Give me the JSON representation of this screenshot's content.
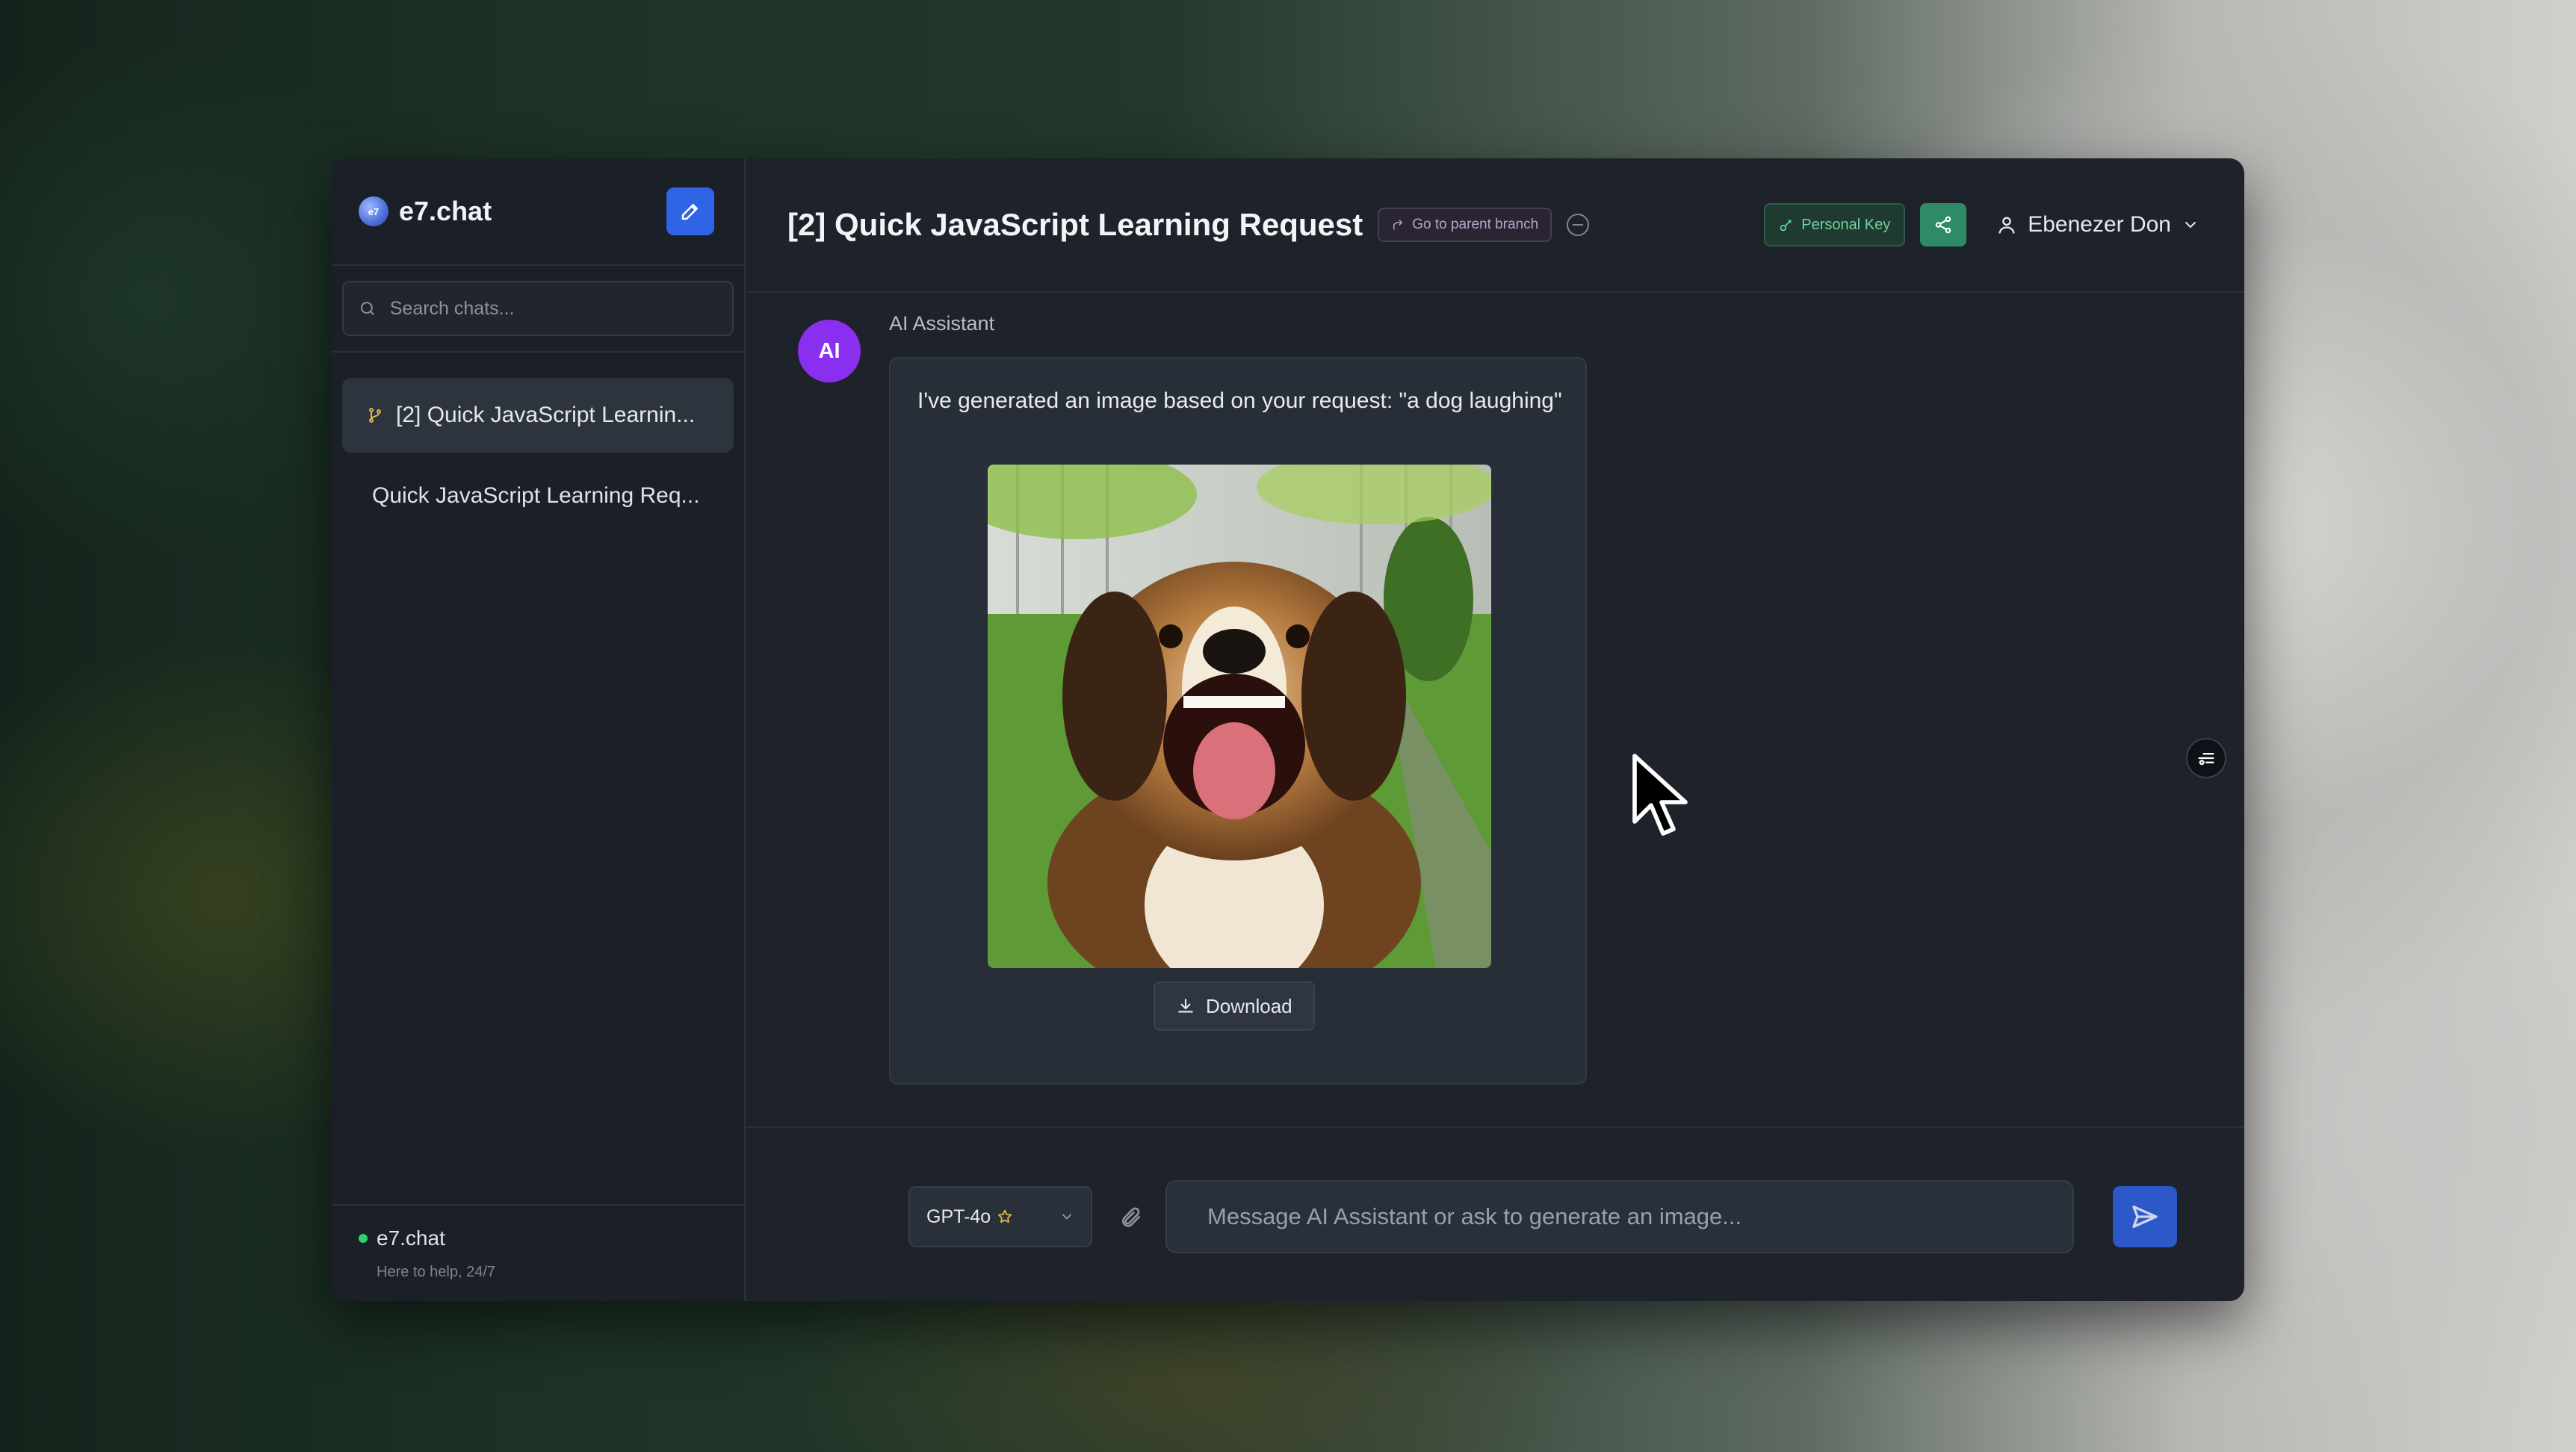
{
  "sidebar": {
    "brand": "e7.chat",
    "search_placeholder": "Search chats...",
    "chats": [
      {
        "label": "[2] Quick JavaScript Learnin...",
        "active": true,
        "branch_icon": "branch-icon"
      },
      {
        "label": "Quick JavaScript Learning Req...",
        "active": false
      }
    ],
    "footer": {
      "name": "e7.chat",
      "tagline": "Here to help, 24/7",
      "status_color": "#2fd06d"
    }
  },
  "header": {
    "title": "[2] Quick JavaScript Learning Request",
    "parent_branch_label": "Go to parent branch",
    "personal_key_label": "Personal Key",
    "user_name": "Ebenezer Don"
  },
  "message": {
    "avatar_initials": "AI",
    "sender": "AI Assistant",
    "text": "I've generated an image based on your request: \"a dog laughing\"",
    "download_label": "Download"
  },
  "composer": {
    "model": "GPT-4o",
    "placeholder": "Message AI Assistant or ask to generate an image..."
  },
  "colors": {
    "accent_blue": "#2f64e6",
    "avatar_purple": "#8a2ff0",
    "key_green": "#6fd3a0",
    "share_green": "#2f8a68"
  }
}
